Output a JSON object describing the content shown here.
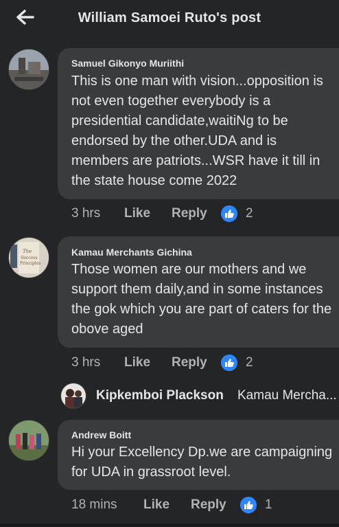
{
  "header": {
    "title": "William Samoei Ruto's post",
    "back_icon": "arrow-left-icon"
  },
  "colors": {
    "background": "#242526",
    "bubble": "#3a3b3c",
    "like_blue": "#2d88ff",
    "meta_text": "#b0b3b8"
  },
  "comments": [
    {
      "author": "Samuel Gikonyo Muriithi",
      "lines": [
        "This is one man with vision...opposition is",
        "not even together everybody is a",
        "presidential candidate,waitiNg to be",
        "endorsed by the other.UDA and is",
        "members are patriots...WSR have it till in",
        "the state house come 2022"
      ],
      "time": "3 hrs",
      "like_label": "Like",
      "reply_label": "Reply",
      "reaction_count": "2"
    },
    {
      "author": "Kamau Merchants Gichina",
      "lines": [
        "Those women are our mothers and we",
        "support them daily,and in some instances",
        "the gok which you are part of caters for the",
        "obove aged"
      ],
      "time": "3 hrs",
      "like_label": "Like",
      "reply_label": "Reply",
      "reaction_count": "2"
    },
    {
      "author": "Andrew Boitt",
      "lines": [
        "Hi your Excellency Dp.we are campaigning",
        "for UDA in grassroot level."
      ],
      "time": "18 mins",
      "like_label": "Like",
      "reply_label": "Reply",
      "reaction_count": "1"
    }
  ],
  "reply_preview": {
    "name": "Kipkemboi Plackson",
    "text": "Kamau Mercha..."
  }
}
